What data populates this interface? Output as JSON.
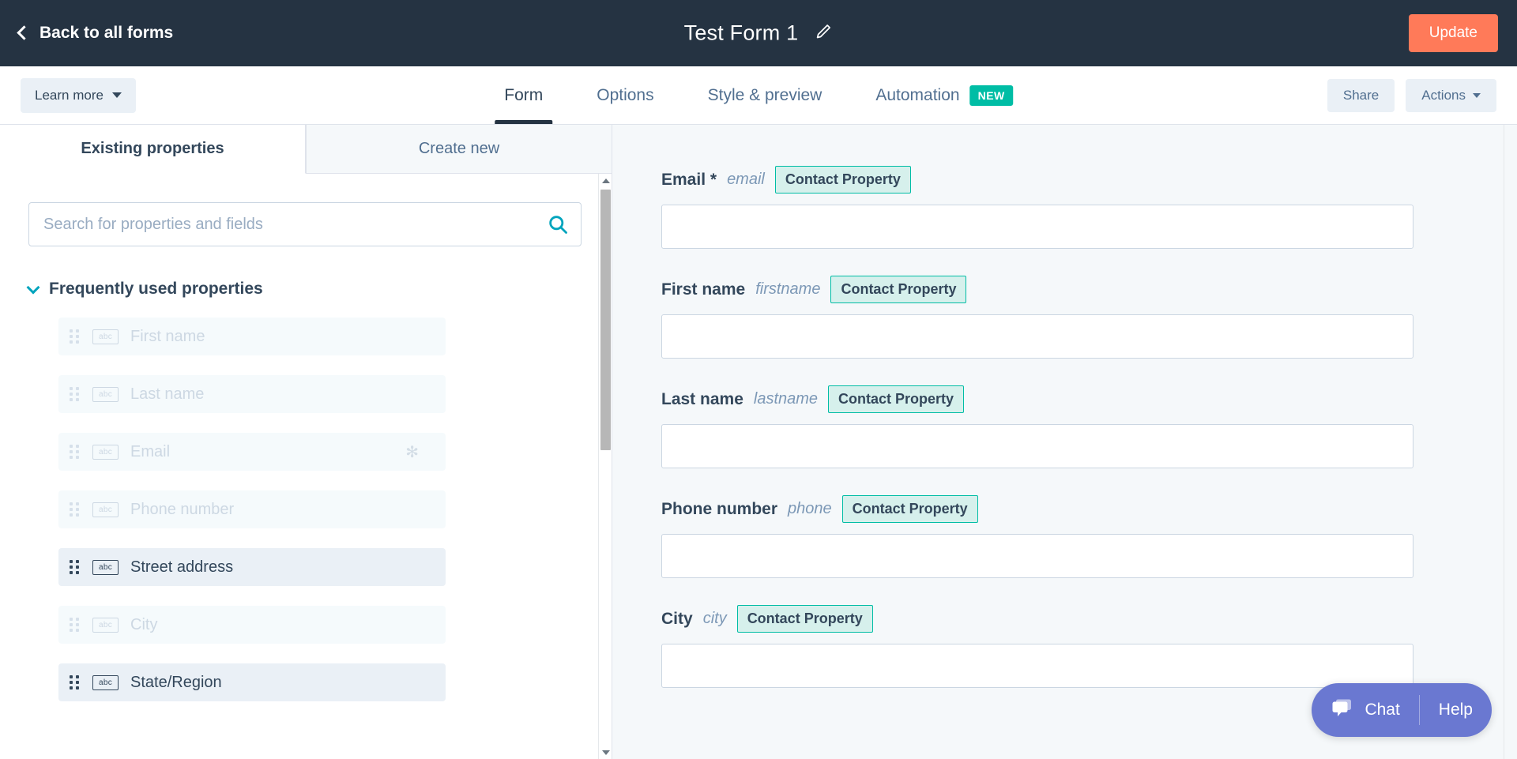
{
  "topbar": {
    "back_label": "Back to all forms",
    "back_icon": "chevron-left-icon",
    "form_title": "Test Form 1",
    "edit_icon": "pencil-icon",
    "update_label": "Update",
    "update_color": "#ff7a59",
    "background_color": "#253342"
  },
  "subnav": {
    "learn_more_label": "Learn more",
    "tabs": [
      {
        "label": "Form",
        "active": true
      },
      {
        "label": "Options",
        "active": false
      },
      {
        "label": "Style & preview",
        "active": false
      },
      {
        "label": "Automation",
        "active": false,
        "badge": "NEW",
        "badge_color": "#00bda5"
      }
    ],
    "share_label": "Share",
    "actions_label": "Actions"
  },
  "sidebar": {
    "tabs": [
      {
        "label": "Existing properties",
        "active": true
      },
      {
        "label": "Create new",
        "active": false
      }
    ],
    "search": {
      "placeholder": "Search for properties and fields",
      "value": "",
      "icon": "search-icon",
      "icon_color": "#00a4bd"
    },
    "group": {
      "title": "Frequently used properties",
      "expanded": true,
      "chevron_icon": "chevron-down-icon"
    },
    "properties": [
      {
        "label": "First name",
        "type_icon": "abc",
        "used": true,
        "required": false
      },
      {
        "label": "Last name",
        "type_icon": "abc",
        "used": true,
        "required": false
      },
      {
        "label": "Email",
        "type_icon": "abc",
        "used": true,
        "required": true,
        "required_mark": "✻"
      },
      {
        "label": "Phone number",
        "type_icon": "abc",
        "used": true,
        "required": false
      },
      {
        "label": "Street address",
        "type_icon": "abc",
        "used": false,
        "required": false
      },
      {
        "label": "City",
        "type_icon": "abc",
        "used": true,
        "required": false
      },
      {
        "label": "State/Region",
        "type_icon": "abc",
        "used": false,
        "required": false
      }
    ]
  },
  "preview": {
    "badge_label": "Contact Property",
    "fields": [
      {
        "label": "Email",
        "required_mark": "*",
        "internal_name": "email",
        "value": ""
      },
      {
        "label": "First name",
        "required_mark": "",
        "internal_name": "firstname",
        "value": ""
      },
      {
        "label": "Last name",
        "required_mark": "",
        "internal_name": "lastname",
        "value": ""
      },
      {
        "label": "Phone number",
        "required_mark": "",
        "internal_name": "phone",
        "value": ""
      },
      {
        "label": "City",
        "required_mark": "",
        "internal_name": "city",
        "value": ""
      }
    ]
  },
  "chat_widget": {
    "chat_label": "Chat",
    "help_label": "Help",
    "icon": "chat-bubble-icon",
    "color": "#6a78d1"
  }
}
